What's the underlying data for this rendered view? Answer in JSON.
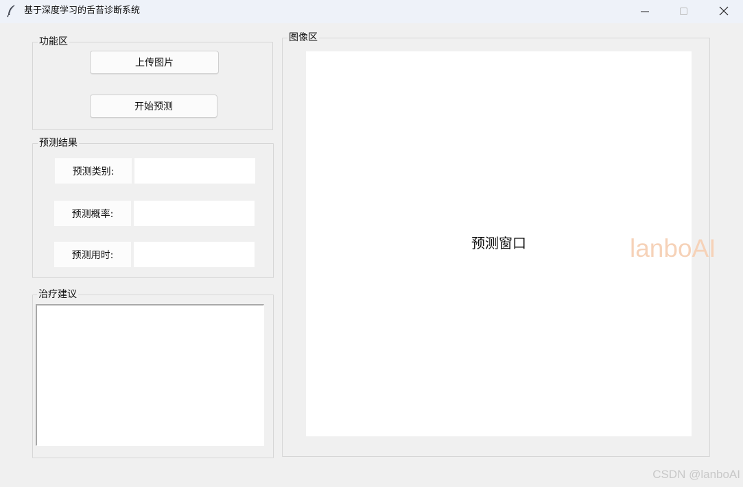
{
  "window": {
    "title": "基于深度学习的舌苔诊断系统",
    "controls": {
      "minimize_icon": "minimize-icon",
      "maximize_icon": "maximize-icon",
      "close_icon": "close-icon"
    }
  },
  "function_area": {
    "label": "功能区",
    "upload_button": "上传图片",
    "predict_button": "开始预测"
  },
  "results": {
    "label": "预测结果",
    "rows": [
      {
        "label": "预测类别:",
        "value": ""
      },
      {
        "label": "预测概率:",
        "value": ""
      },
      {
        "label": "预测用时:",
        "value": ""
      }
    ]
  },
  "advice": {
    "label": "治疗建议",
    "text": ""
  },
  "image_area": {
    "label": "图像区",
    "canvas_text": "预测窗口"
  },
  "watermarks": {
    "overlay": "lanboAI",
    "footer": "CSDN @lanboAI"
  },
  "colors": {
    "window_bg": "#f0f0f0",
    "titlebar_bg": "#eef2f9",
    "watermark": "#f6d2b8"
  }
}
